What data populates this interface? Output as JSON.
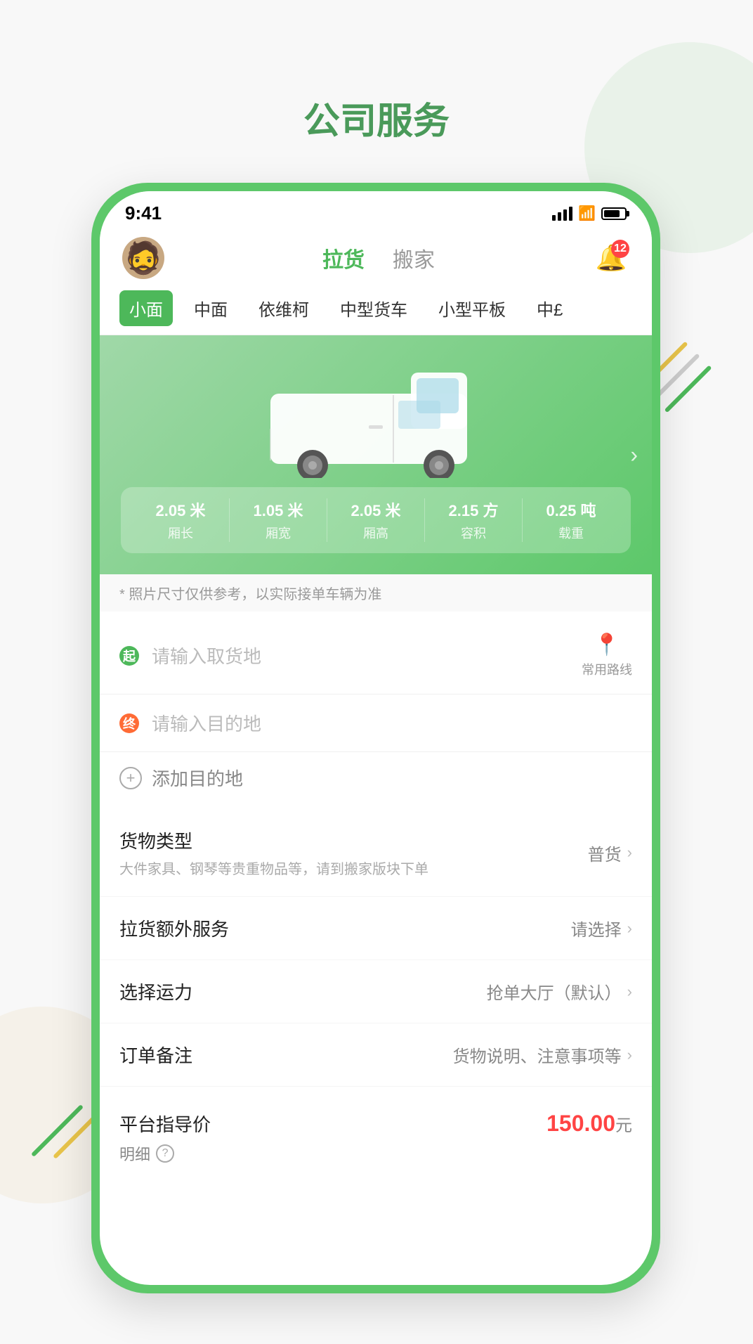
{
  "page": {
    "title": "公司服务",
    "background_color": "#f8f8f8"
  },
  "status_bar": {
    "time": "9:41",
    "badge_count": "12"
  },
  "header": {
    "nav_tabs": [
      {
        "id": "lahuo",
        "label": "拉货",
        "active": true
      },
      {
        "id": "banjia",
        "label": "搬家",
        "active": false
      }
    ],
    "notification_badge": "12"
  },
  "vehicle_tabs": [
    {
      "id": "xiaomian",
      "label": "小面",
      "active": true
    },
    {
      "id": "zhongmian",
      "label": "中面",
      "active": false
    },
    {
      "id": "yiweike",
      "label": "依维柯",
      "active": false
    },
    {
      "id": "zhonghuo",
      "label": "中型货车",
      "active": false
    },
    {
      "id": "xiaoping",
      "label": "小型平板",
      "active": false
    },
    {
      "id": "zhong2",
      "label": "中£",
      "active": false
    }
  ],
  "vehicle": {
    "specs": [
      {
        "value": "2.05 米",
        "label": "厢长"
      },
      {
        "value": "1.05 米",
        "label": "厢宽"
      },
      {
        "value": "2.05 米",
        "label": "厢高"
      },
      {
        "value": "2.15 方",
        "label": "容积"
      },
      {
        "value": "0.25 吨",
        "label": "载重"
      }
    ],
    "disclaimer": "* 照片尺寸仅供参考，以实际接单车辆为准"
  },
  "form": {
    "pickup_placeholder": "请输入取货地",
    "destination_placeholder": "请输入目的地",
    "add_destination_label": "添加目的地",
    "route_label": "常用路线",
    "start_dot": "起",
    "end_dot": "终"
  },
  "options": [
    {
      "id": "cargo-type",
      "title": "货物类型",
      "subtitle": "大件家具、钢琴等贵重物品等，请到搬家版块下单",
      "value": "普货",
      "has_chevron": true
    },
    {
      "id": "extra-service",
      "title": "拉货额外服务",
      "subtitle": "",
      "value": "请选择",
      "has_chevron": true
    },
    {
      "id": "transport",
      "title": "选择运力",
      "subtitle": "",
      "value": "抢单大厅（默认）",
      "has_chevron": true
    },
    {
      "id": "order-note",
      "title": "订单备注",
      "subtitle": "",
      "value": "货物说明、注意事项等",
      "has_chevron": true
    }
  ],
  "price": {
    "label": "平台指导价",
    "value": "150.00",
    "unit": "元",
    "detail_label": "明细"
  },
  "colors": {
    "primary_green": "#4db85a",
    "accent_red": "#ff4444",
    "accent_orange": "#ff6b35"
  }
}
